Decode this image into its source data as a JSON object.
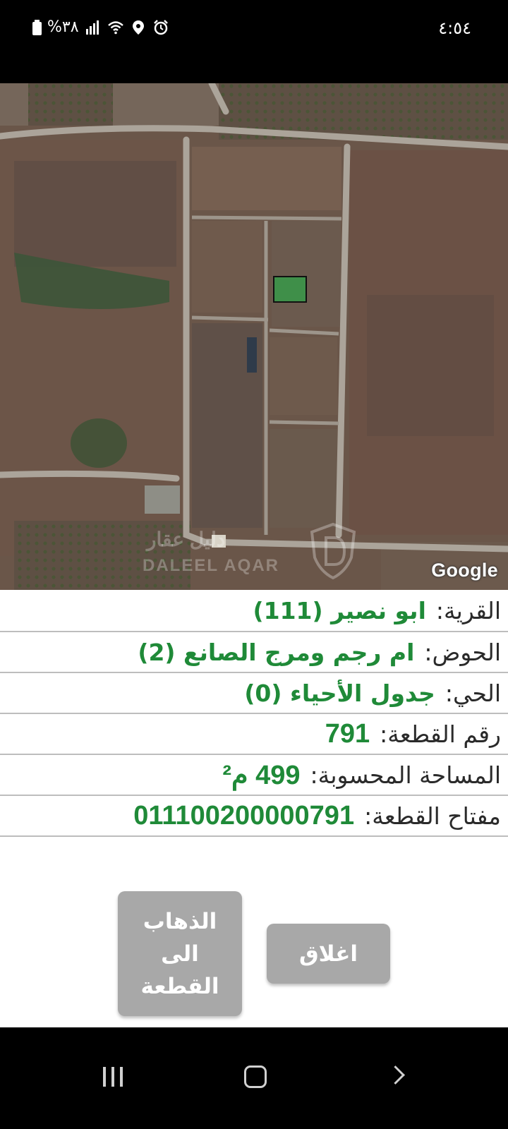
{
  "status_bar": {
    "time": "٤:٥٤",
    "battery": "%٣٨"
  },
  "map": {
    "attribution": "Google",
    "watermark_ar": "دليل عقار",
    "watermark_en": "DALEEL AQAR"
  },
  "parcel_info": [
    {
      "label": "القرية:",
      "value": "ابو نصير (111)"
    },
    {
      "label": "الحوض:",
      "value": "ام رجم ومرج الصانع (2)"
    },
    {
      "label": "الحي:",
      "value": "جدول الأحياء (0)"
    },
    {
      "label": "رقم القطعة:",
      "value": "791"
    },
    {
      "label": "المساحة المحسوبة:",
      "value": "499 م²"
    },
    {
      "label": "مفتاح القطعة:",
      "value": "011100200000791"
    }
  ],
  "buttons": {
    "goto_parcel": "الذهاب الى القطعة",
    "close": "اغلاق"
  },
  "colors": {
    "value_text": "#1f8a38",
    "button_bg": "#a8a8a8",
    "parcel_highlight": "#3f8f49"
  }
}
